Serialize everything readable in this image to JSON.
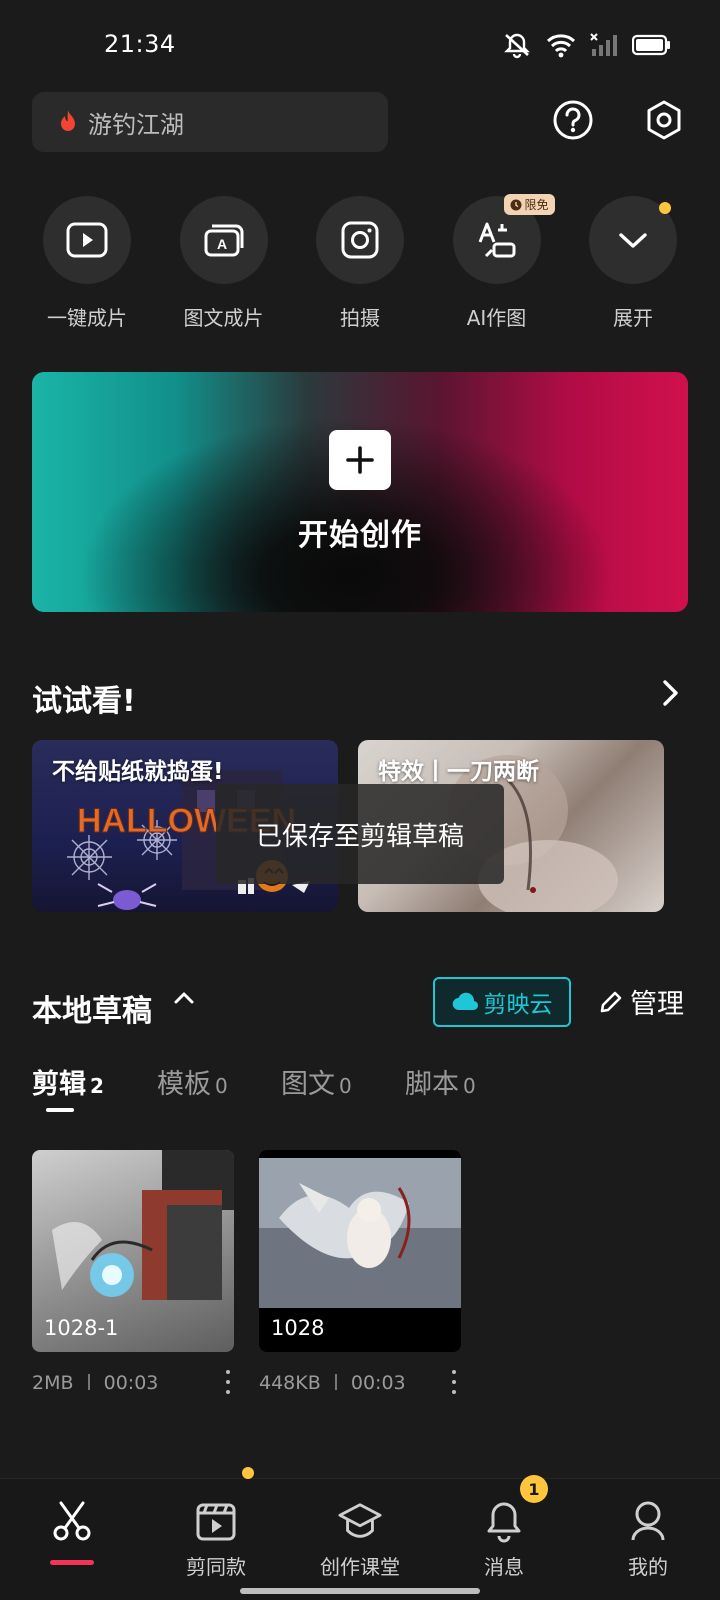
{
  "status_bar": {
    "time": "21:34"
  },
  "search": {
    "text": "游钓江湖"
  },
  "quick_actions": [
    {
      "label": "一键成片",
      "icon": "play-rect-icon"
    },
    {
      "label": "图文成片",
      "icon": "text-card-icon"
    },
    {
      "label": "拍摄",
      "icon": "camera-icon"
    },
    {
      "label": "AI作图",
      "icon": "ai-draw-icon",
      "badge": "限免"
    },
    {
      "label": "展开",
      "icon": "chevron-down-icon"
    }
  ],
  "create": {
    "label": "开始创作"
  },
  "try_section": {
    "title": "试试看!",
    "cards": [
      {
        "label": "不给贴纸就捣蛋!",
        "art_text": "HALLOWEEN"
      },
      {
        "label": "特效丨一刀两断"
      }
    ]
  },
  "toast": "已保存至剪辑草稿",
  "drafts": {
    "title": "本地草稿",
    "cloud_label": "剪映云",
    "manage_label": "管理",
    "tabs": [
      {
        "label": "剪辑",
        "count": "2"
      },
      {
        "label": "模板",
        "count": "0"
      },
      {
        "label": "图文",
        "count": "0"
      },
      {
        "label": "脚本",
        "count": "0"
      }
    ],
    "items": [
      {
        "name": "1028-1",
        "size": "2MB",
        "duration": "00:03"
      },
      {
        "name": "1028",
        "size": "448KB",
        "duration": "00:03"
      }
    ]
  },
  "bottom_nav": {
    "items": [
      {
        "label": "",
        "icon": "scissors-icon"
      },
      {
        "label": "剪同款",
        "icon": "template-clip-icon"
      },
      {
        "label": "创作课堂",
        "icon": "graduation-cap-icon"
      },
      {
        "label": "消息",
        "icon": "bell-icon",
        "badge": "1"
      },
      {
        "label": "我的",
        "icon": "user-icon"
      }
    ]
  },
  "colors": {
    "accent_cyan": "#1fc6d8",
    "accent_red": "#f4335a",
    "badge_yellow": "#ffc53d",
    "background": "#1b1b1b"
  }
}
